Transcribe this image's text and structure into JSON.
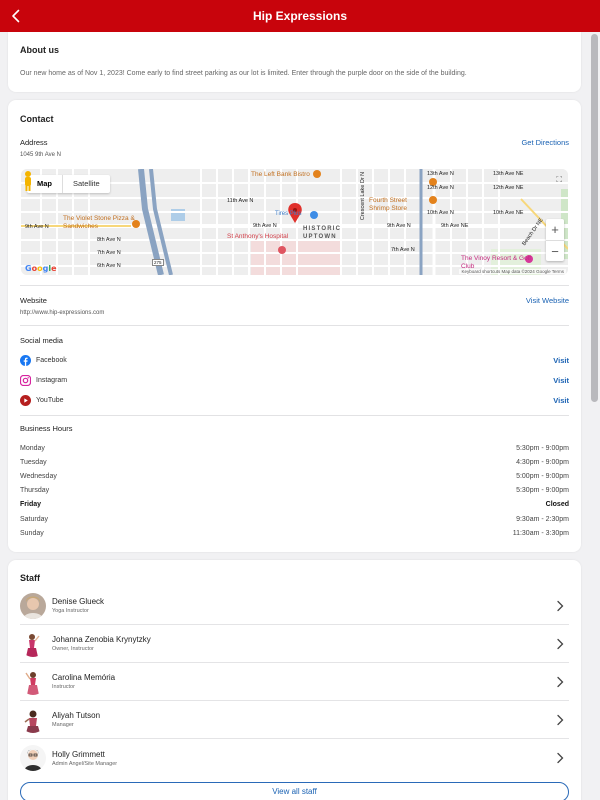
{
  "header": {
    "title": "Hip Expressions"
  },
  "about": {
    "title": "About us",
    "body": "Our new home as of Nov 1, 2023! Come early to find street parking as our lot is limited.  Enter through the purple door on the side of the building."
  },
  "contact": {
    "title": "Contact",
    "address_label": "Address",
    "address": "1045 9th Ave N",
    "directions_label": "Get Directions",
    "map": {
      "tab_map": "Map",
      "tab_satellite": "Satellite",
      "labels": {
        "bistro": "The Left Bank Bistro",
        "shrimp": "Fourth Street Shrimp Store",
        "violet": "The Violet Stone Pizza & Sandwiches",
        "hospital": "St Anthony's Hospital",
        "historic": "HISTORIC UPTOWN",
        "vinoy": "The Vinoy Resort & Golf Club",
        "tires": "Tires Plus",
        "ave9": "9th Ave N",
        "ave9e": "9th Ave NE",
        "ave8": "8th Ave N",
        "ave7": "7th Ave N",
        "ave6": "6th Ave N",
        "ave11": "11th Ave N",
        "ave12": "12th Ave N",
        "ave13": "13th Ave N",
        "ave10": "10th Ave N",
        "ave12e": "12th Ave NE",
        "ave10e": "10th Ave NE",
        "ave13e": "13th Ave NE",
        "beach": "Beach Dr NE",
        "crescent": "Crescent Lake Dr N",
        "i275": "275"
      },
      "google": "Google",
      "attribution": "Keyboard shortcuts   Map data ©2024 Google   Terms"
    },
    "website_label": "Website",
    "website_url": "http://www.hip-expressions.com",
    "visit_website": "Visit Website",
    "social_label": "Social media",
    "social": [
      {
        "name": "Facebook",
        "action": "Visit",
        "icon": "facebook-icon",
        "color": "#1877f2"
      },
      {
        "name": "Instagram",
        "action": "Visit",
        "icon": "instagram-icon",
        "color": "#d6249f"
      },
      {
        "name": "YouTube",
        "action": "Visit",
        "icon": "youtube-icon",
        "color": "#b51f1f"
      }
    ],
    "hours_label": "Business Hours",
    "hours": [
      {
        "day": "Monday",
        "time": "5:30pm - 9:00pm"
      },
      {
        "day": "Tuesday",
        "time": "4:30pm - 9:00pm"
      },
      {
        "day": "Wednesday",
        "time": "5:00pm - 9:00pm"
      },
      {
        "day": "Thursday",
        "time": "5:30pm - 9:00pm"
      },
      {
        "day": "Friday",
        "time": "Closed"
      },
      {
        "day": "Saturday",
        "time": "9:30am - 2:30pm"
      },
      {
        "day": "Sunday",
        "time": "11:30am - 3:30pm"
      }
    ]
  },
  "staff": {
    "title": "Staff",
    "members": [
      {
        "name": "Denise Glueck",
        "role": "Yoga Instructor"
      },
      {
        "name": "Johanna Zenobia Krynytzky",
        "role": "Owner, Instructor"
      },
      {
        "name": "Carolina Memória",
        "role": "Instructor"
      },
      {
        "name": "Aliyah Tutson",
        "role": "Manager"
      },
      {
        "name": "Holly Grimmett",
        "role": "Admin Angel/Site Manager"
      }
    ],
    "view_all": "View all staff"
  },
  "colors": {
    "brand": "#c8040c",
    "link": "#1a62b3"
  }
}
